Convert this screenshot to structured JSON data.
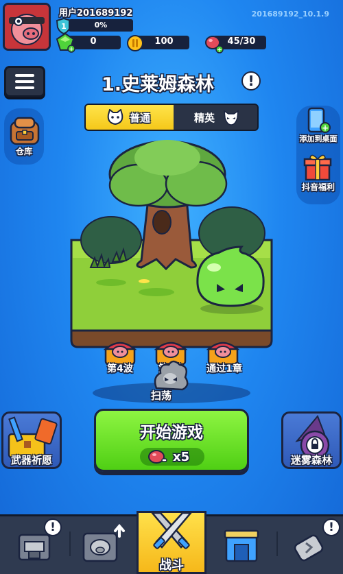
{
  "player": {
    "username": "用户201689192",
    "build_id": "201689192_10.1.9",
    "xp_percent": 0,
    "xp_text": "0%",
    "level": "1"
  },
  "resources": {
    "gems": "0",
    "coins": "100",
    "stamina": "45/30"
  },
  "stage": {
    "title": "1.史莱姆森林",
    "info": "!"
  },
  "modes": {
    "normal": "普通",
    "elite": "精英"
  },
  "side_left": {
    "warehouse": "仓库"
  },
  "side_right": {
    "add_desktop": "添加到桌面",
    "douyin_benefit": "抖音福利"
  },
  "rewards": [
    {
      "label": "第4波"
    },
    {
      "label": "第?波"
    },
    {
      "label": "通过1章"
    }
  ],
  "sweep": {
    "label": "扫荡"
  },
  "start": {
    "label": "开始游戏",
    "cost": "x5"
  },
  "corners": {
    "weapon_wish": "武器祈愿",
    "mist_forest": "迷雾森林"
  },
  "nav": {
    "battle": "战斗",
    "badge": "!"
  },
  "colors": {
    "background": "#1f86f0",
    "start_button": "#5fd81e",
    "active_tab": "#f5c81a",
    "outline": "#1b2440"
  }
}
